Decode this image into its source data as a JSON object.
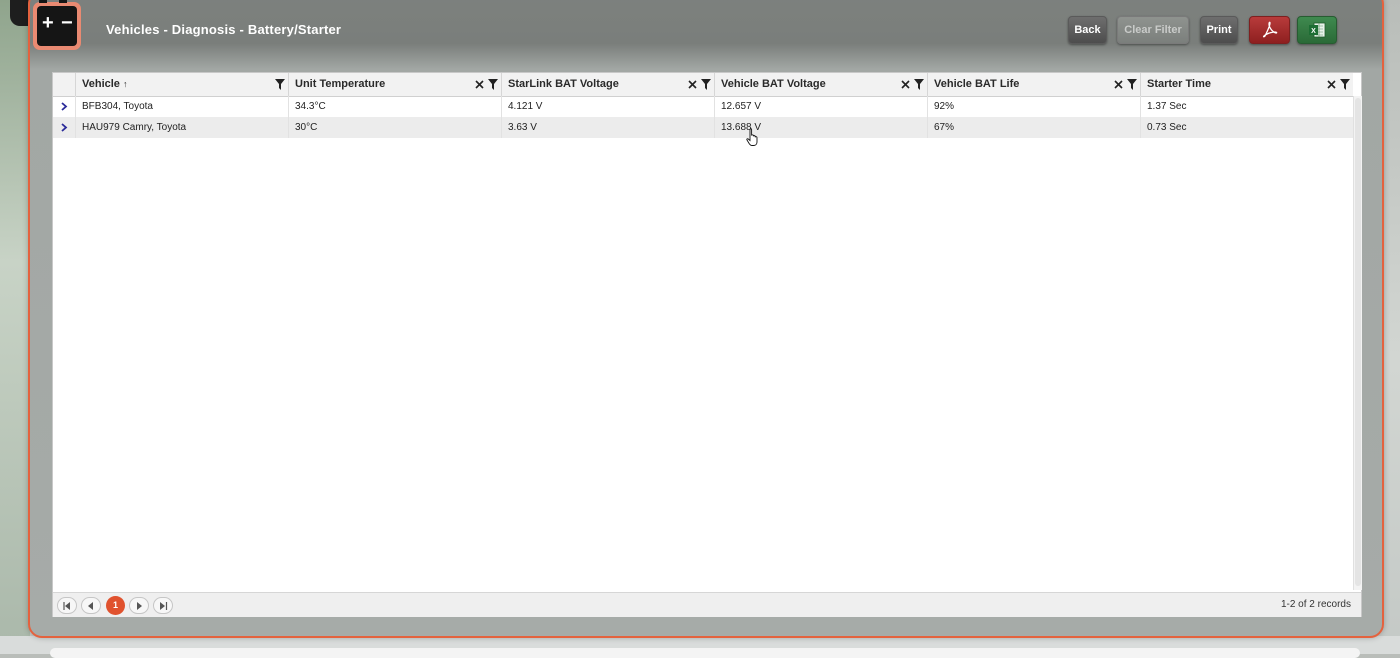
{
  "header": {
    "title": "Vehicles - Diagnosis - Battery/Starter",
    "icon": "car-battery-icon"
  },
  "toolbar": {
    "back_label": "Back",
    "clear_filter_label": "Clear Filter",
    "print_label": "Print",
    "pdf_icon": "pdf-export-icon",
    "excel_icon": "excel-export-icon"
  },
  "grid": {
    "columns": [
      {
        "label": "Vehicle",
        "sort": "↑"
      },
      {
        "label": "Unit Temperature"
      },
      {
        "label": "StarLink BAT Voltage"
      },
      {
        "label": "Vehicle BAT Voltage"
      },
      {
        "label": "Vehicle BAT Life"
      },
      {
        "label": "Starter Time"
      }
    ],
    "rows": [
      [
        "BFB304, Toyota",
        "34.3°C",
        "4.121 V",
        "12.657 V",
        "92%",
        "1.37 Sec"
      ],
      [
        "HAU979 Camry, Toyota",
        "30°C",
        "3.63 V",
        "13.688 V",
        "67%",
        "0.73 Sec"
      ]
    ]
  },
  "pager": {
    "current_page": "1",
    "records_text": "1-2 of 2 records"
  },
  "colors": {
    "accent": "#e0522e",
    "expand_arrow": "#2b2b9a"
  }
}
